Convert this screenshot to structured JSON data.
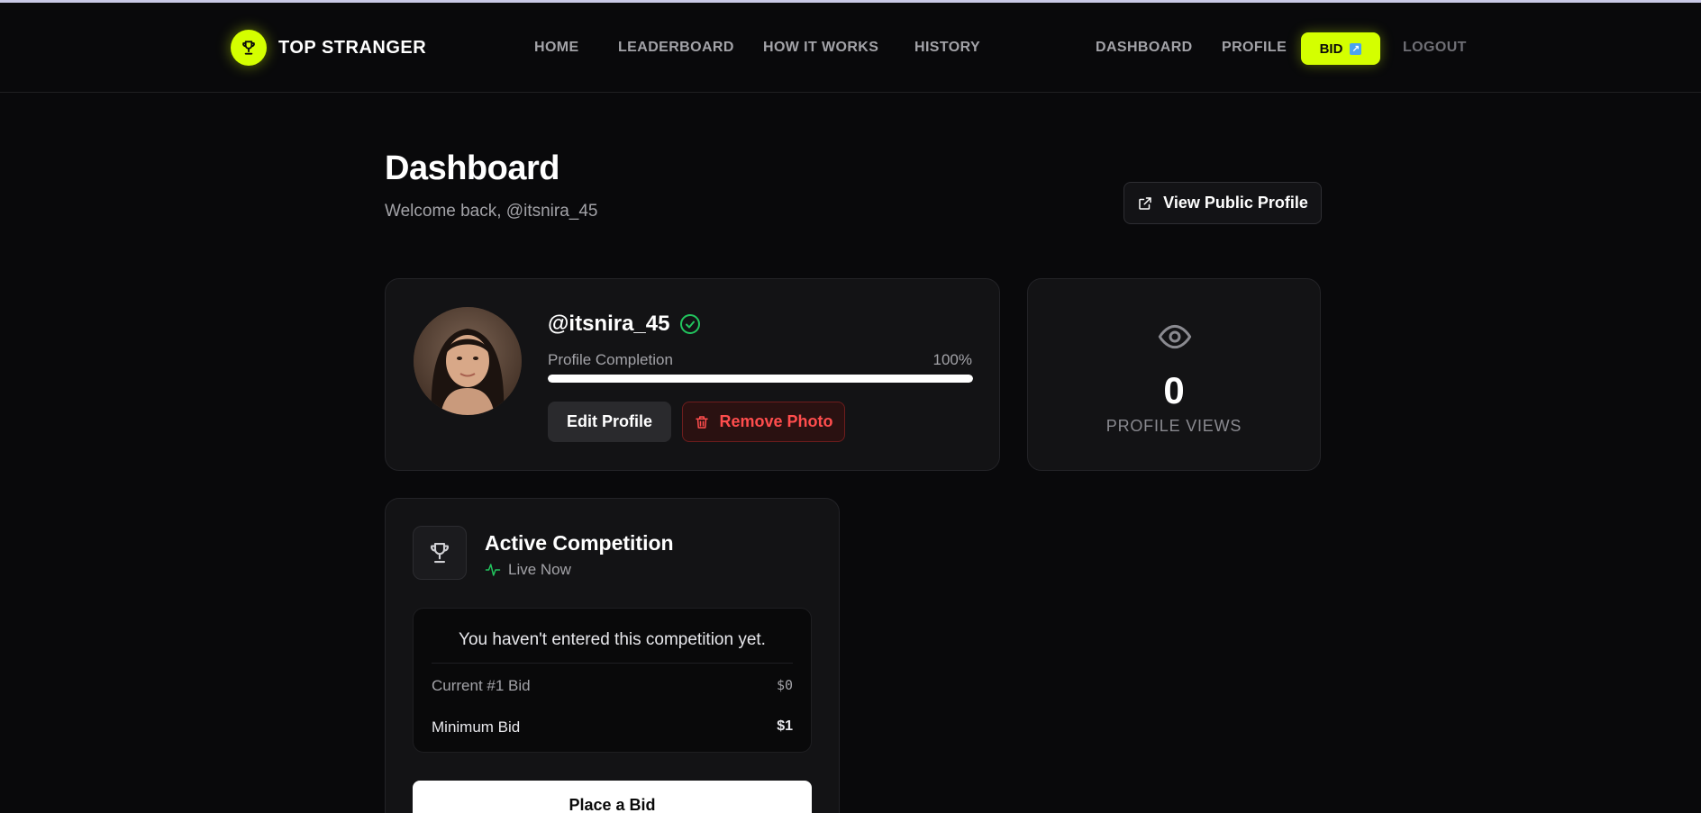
{
  "brand": {
    "name": "TOP STRANGER",
    "accent": "#d4ff00"
  },
  "nav": {
    "left": [
      "HOME",
      "LEADERBOARD",
      "HOW IT WORKS",
      "HISTORY"
    ],
    "right": [
      "DASHBOARD",
      "PROFILE"
    ],
    "bid": "BID",
    "logout": "LOGOUT"
  },
  "header": {
    "title": "Dashboard",
    "welcome": "Welcome back, @itsnira_45",
    "view_public_profile": "View Public Profile"
  },
  "profile": {
    "username": "@itsnira_45",
    "verified": true,
    "completion_label": "Profile Completion",
    "completion_value": "100%",
    "completion_fraction": 1.0,
    "edit_label": "Edit Profile",
    "remove_label": "Remove Photo"
  },
  "views": {
    "count": "0",
    "label": "PROFILE VIEWS"
  },
  "competition": {
    "title": "Active Competition",
    "status": "Live Now",
    "message": "You haven't entered this competition yet.",
    "rows": [
      {
        "label": "Current #1 Bid",
        "value": "$0"
      },
      {
        "label": "Minimum Bid",
        "value": "$1"
      }
    ],
    "cta": "Place a Bid"
  },
  "colors": {
    "live_green": "#22c55e",
    "danger": "#ff4d4d",
    "verified_green": "#22c55e"
  }
}
